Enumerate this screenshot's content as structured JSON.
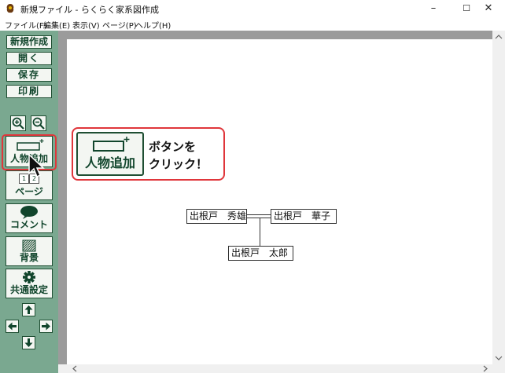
{
  "window": {
    "title": "新規ファイル - らくらく家系図作成",
    "minimize": "–",
    "maximize": "☐",
    "close": "✕"
  },
  "menu": [
    "ファイル(F)",
    "編集(E)",
    "表示(V)",
    "ページ(P)",
    "ヘルプ(H)"
  ],
  "sidebar": {
    "new": "新規作成",
    "open": "開く",
    "save": "保存",
    "print": "印刷",
    "add_person": "人物追加",
    "page": "ページ",
    "page_tabs": [
      "1",
      "2"
    ],
    "comment": "コメント",
    "background": "背景",
    "common_settings": "共通設定"
  },
  "family_tree": {
    "father": "出根戸　秀雄",
    "mother": "出根戸　華子",
    "child": "出根戸　太郎"
  },
  "callout": {
    "button_label": "人物追加",
    "line1": "ボタンを",
    "line2": "クリック！"
  },
  "colors": {
    "sidebar": "#7aa890",
    "button_text": "#11452c",
    "highlight": "#e0363b",
    "canvas_bg": "#9b9b9b"
  }
}
